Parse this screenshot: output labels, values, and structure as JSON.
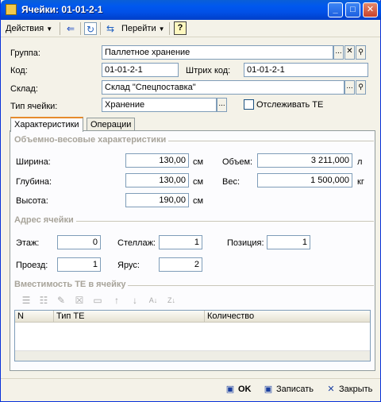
{
  "window": {
    "title": "Ячейки: 01-01-2-1",
    "minimize": "_",
    "maximize": "□",
    "close": "✕"
  },
  "toolbar": {
    "actions_label": "Действия",
    "goto_label": "Перейти",
    "help_label": "?",
    "icons": [
      "back-arrow-icon",
      "refresh-icon",
      "structure-icon",
      "help-icon"
    ]
  },
  "form": {
    "group_label": "Группа:",
    "group_value": "Паллетное хранение",
    "code_label": "Код:",
    "code_value": "01-01-2-1",
    "barcode_label": "Штрих код:",
    "barcode_value": "01-01-2-1",
    "warehouse_label": "Склад:",
    "warehouse_value": "Склад \"Спецпоставка\"",
    "cell_type_label": "Тип ячейки:",
    "cell_type_value": "Хранение",
    "track_te_label": "Отслеживать ТЕ",
    "track_te_checked": false,
    "select_btn": "...",
    "clear_btn": "✕",
    "search_btn": "🔍"
  },
  "tabs": [
    {
      "label": "Характеристики",
      "active": true
    },
    {
      "label": "Операции",
      "active": false
    }
  ],
  "characteristics": {
    "group_title": "Объемно-весовые характеристики",
    "width_label": "Ширина:",
    "width_value": "130,00",
    "width_unit": "см",
    "depth_label": "Глубина:",
    "depth_value": "130,00",
    "depth_unit": "см",
    "height_label": "Высота:",
    "height_value": "190,00",
    "height_unit": "см",
    "volume_label": "Объем:",
    "volume_value": "3 211,000",
    "volume_unit": "л",
    "weight_label": "Вес:",
    "weight_value": "1 500,000",
    "weight_unit": "кг"
  },
  "address": {
    "group_title": "Адрес ячейки",
    "floor_label": "Этаж:",
    "floor_value": "0",
    "rack_label": "Стеллаж:",
    "rack_value": "1",
    "position_label": "Позиция:",
    "position_value": "1",
    "aisle_label": "Проезд:",
    "aisle_value": "1",
    "tier_label": "Ярус:",
    "tier_value": "2"
  },
  "capacity": {
    "group_title": "Вместимость ТЕ в ячейку",
    "columns": [
      "N",
      "Тип ТЕ",
      "Количество"
    ],
    "rows": []
  },
  "buttons": {
    "ok": "OK",
    "save": "Записать",
    "close": "Закрыть"
  },
  "colors": {
    "titlebar": "#0058ee",
    "accent_tab": "#e68b2c"
  }
}
